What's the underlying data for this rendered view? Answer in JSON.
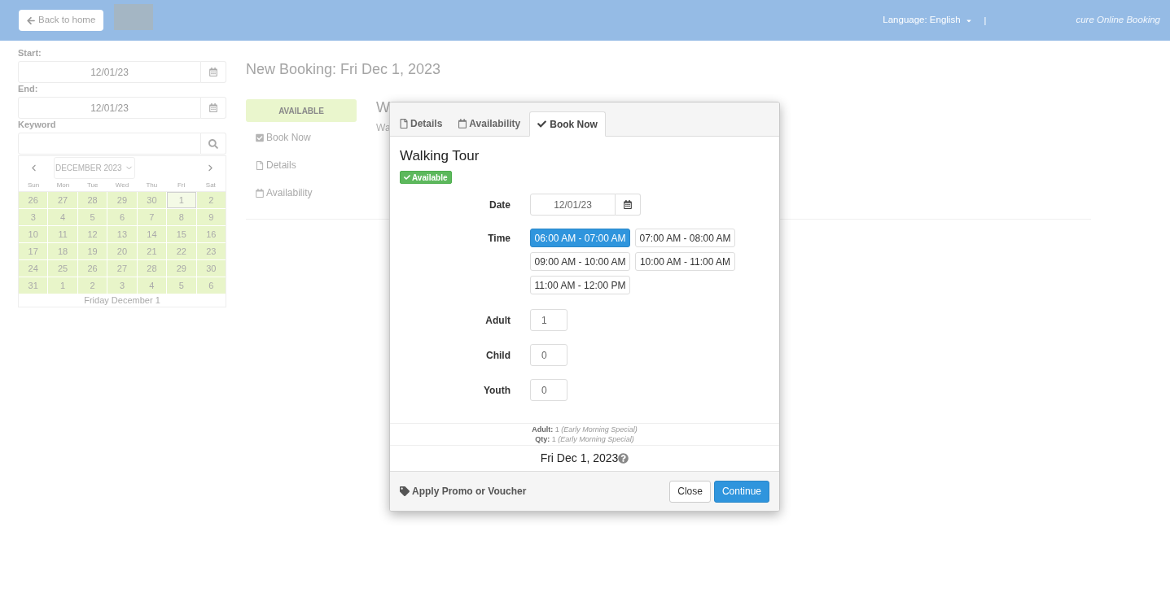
{
  "header": {
    "back_button": "Back to home",
    "language": "Language: English",
    "separator": "|",
    "tagline": "cure Online Booking"
  },
  "sidebar": {
    "start": {
      "label": "Start:",
      "value": "12/01/23"
    },
    "end": {
      "label": "End:",
      "value": "12/01/23"
    },
    "keyword": {
      "label": "Keyword"
    },
    "calendar": {
      "month": "DECEMBER 2023",
      "weekdays": [
        "Sun",
        "Mon",
        "Tue",
        "Wed",
        "Thu",
        "Fri",
        "Sat"
      ],
      "days": [
        {
          "day": "26",
          "selected": false
        },
        {
          "day": "27",
          "selected": false
        },
        {
          "day": "28",
          "selected": false
        },
        {
          "day": "29",
          "selected": false
        },
        {
          "day": "30",
          "selected": false
        },
        {
          "day": "1",
          "selected": true
        },
        {
          "day": "2",
          "selected": false
        },
        {
          "day": "3",
          "selected": false
        },
        {
          "day": "4",
          "selected": false
        },
        {
          "day": "5",
          "selected": false
        },
        {
          "day": "6",
          "selected": false
        },
        {
          "day": "7",
          "selected": false
        },
        {
          "day": "8",
          "selected": false
        },
        {
          "day": "9",
          "selected": false
        },
        {
          "day": "10",
          "selected": false
        },
        {
          "day": "11",
          "selected": false
        },
        {
          "day": "12",
          "selected": false
        },
        {
          "day": "13",
          "selected": false
        },
        {
          "day": "14",
          "selected": false
        },
        {
          "day": "15",
          "selected": false
        },
        {
          "day": "16",
          "selected": false
        },
        {
          "day": "17",
          "selected": false
        },
        {
          "day": "18",
          "selected": false
        },
        {
          "day": "19",
          "selected": false
        },
        {
          "day": "20",
          "selected": false
        },
        {
          "day": "21",
          "selected": false
        },
        {
          "day": "22",
          "selected": false
        },
        {
          "day": "23",
          "selected": false
        },
        {
          "day": "24",
          "selected": false
        },
        {
          "day": "25",
          "selected": false
        },
        {
          "day": "26",
          "selected": false
        },
        {
          "day": "27",
          "selected": false
        },
        {
          "day": "28",
          "selected": false
        },
        {
          "day": "29",
          "selected": false
        },
        {
          "day": "30",
          "selected": false
        },
        {
          "day": "31",
          "selected": false
        },
        {
          "day": "1",
          "selected": false
        },
        {
          "day": "2",
          "selected": false
        },
        {
          "day": "3",
          "selected": false
        },
        {
          "day": "4",
          "selected": false
        },
        {
          "day": "5",
          "selected": false
        },
        {
          "day": "6",
          "selected": false
        }
      ],
      "footer": "Friday December 1"
    }
  },
  "main": {
    "title": "New Booking: Fri Dec 1, 2023",
    "status": "AVAILABLE",
    "nav": [
      "Book Now",
      "Details",
      "Availability"
    ],
    "product_heading": "W",
    "product_text": "Wa"
  },
  "modal": {
    "tabs": [
      {
        "label": "Details",
        "selected": false
      },
      {
        "label": "Availability",
        "selected": false
      },
      {
        "label": "Book Now",
        "selected": true
      }
    ],
    "title": "Walking Tour",
    "badge": "Available",
    "date": {
      "label": "Date",
      "value": "12/01/23"
    },
    "time": {
      "label": "Time",
      "slots": [
        {
          "label": "06:00 AM - 07:00 AM",
          "selected": true
        },
        {
          "label": "07:00 AM - 08:00 AM",
          "selected": false
        },
        {
          "label": "09:00 AM - 10:00 AM",
          "selected": false
        },
        {
          "label": "10:00 AM - 11:00 AM",
          "selected": false
        },
        {
          "label": "11:00 AM - 12:00 PM",
          "selected": false
        }
      ]
    },
    "quantities": [
      {
        "label": "Adult",
        "value": "1"
      },
      {
        "label": "Child",
        "value": "0"
      },
      {
        "label": "Youth",
        "value": "0"
      }
    ],
    "summary": [
      "**Adult:** 1 *(Early Morning Special)*",
      "**Qty:** 1 *(Early Morning Special)*"
    ],
    "selected_date": "Fri Dec 1, 2023",
    "promo": "Apply Promo or Voucher",
    "buttons": [
      {
        "label": "Close",
        "kind": "default"
      },
      {
        "label": "Continue",
        "kind": "primary"
      }
    ]
  }
}
